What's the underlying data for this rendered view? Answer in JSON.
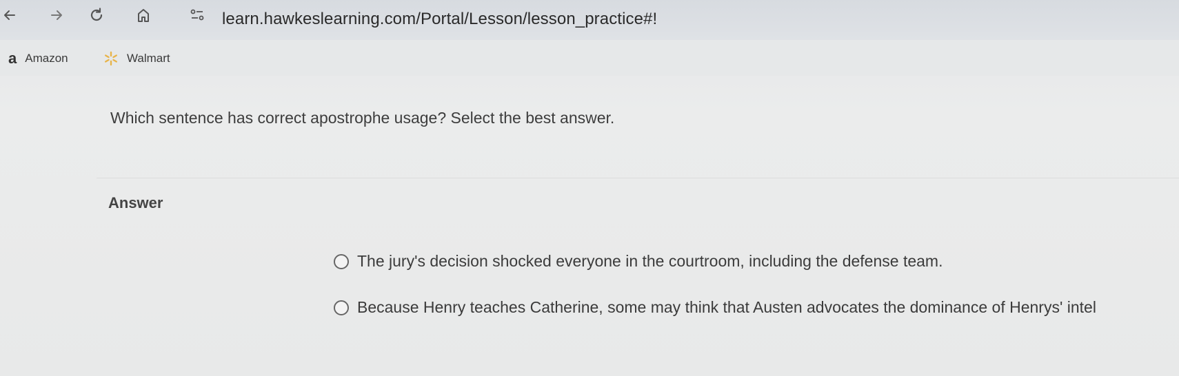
{
  "browser": {
    "url": "learn.hawkeslearning.com/Portal/Lesson/lesson_practice#!",
    "nav_icons": [
      "back-arrow-icon",
      "forward-arrow-icon",
      "reload-icon",
      "home-icon",
      "site-info-icon"
    ]
  },
  "bookmarks": [
    {
      "label": "Amazon",
      "icon": "amazon-icon"
    },
    {
      "label": "Walmart",
      "icon": "walmart-spark-icon"
    }
  ],
  "lesson": {
    "question": "Which sentence has correct apostrophe usage? Select the best answer.",
    "answer_heading": "Answer",
    "choices": [
      "The jury's decision shocked everyone in the courtroom, including the defense team.",
      "Because Henry teaches Catherine, some may think that Austen advocates the dominance of Henrys' intel"
    ]
  },
  "colors": {
    "walmart_spark": "#e8b44a",
    "text": "#3b3b3b"
  }
}
